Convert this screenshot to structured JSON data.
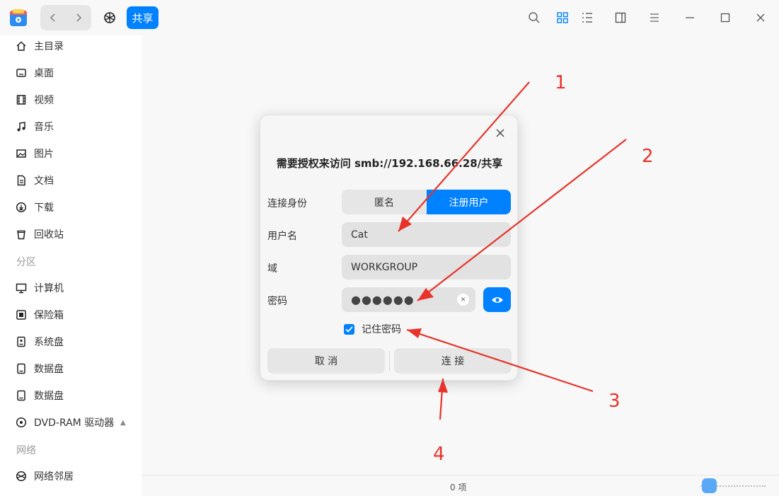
{
  "breadcrumb": {
    "current": "共享"
  },
  "sidebar": {
    "items": [
      {
        "label": "主目录",
        "icon": "home-icon"
      },
      {
        "label": "桌面",
        "icon": "desktop-icon"
      },
      {
        "label": "视频",
        "icon": "video-icon"
      },
      {
        "label": "音乐",
        "icon": "music-icon"
      },
      {
        "label": "图片",
        "icon": "image-icon"
      },
      {
        "label": "文档",
        "icon": "document-icon"
      },
      {
        "label": "下载",
        "icon": "download-icon"
      },
      {
        "label": "回收站",
        "icon": "trash-icon"
      }
    ],
    "partition_header": "分区",
    "partitions": [
      {
        "label": "计算机",
        "icon": "computer-icon"
      },
      {
        "label": "保险箱",
        "icon": "vault-icon"
      },
      {
        "label": "系统盘",
        "icon": "disk-icon"
      },
      {
        "label": "数据盘",
        "icon": "disk-icon"
      },
      {
        "label": "数据盘",
        "icon": "disk-icon"
      },
      {
        "label": "DVD-RAM 驱动器",
        "icon": "optical-drive-icon"
      }
    ],
    "network_header": "网络",
    "network": [
      {
        "label": "网络邻居",
        "icon": "network-icon"
      }
    ]
  },
  "status": {
    "count": "0 项"
  },
  "dialog": {
    "title": "需要授权来访问 smb://192.168.66.28/共享",
    "identity_label": "连接身份",
    "identity_options": [
      "匿名",
      "注册用户"
    ],
    "identity_selected": "注册用户",
    "username_label": "用户名",
    "username_value": "Cat",
    "domain_label": "域",
    "domain_value": "WORKGROUP",
    "password_label": "密码",
    "password_mask": "●●●●●●",
    "remember_label": "记住密码",
    "remember_checked": true,
    "cancel_label": "取 消",
    "connect_label": "连 接"
  },
  "annotations": {
    "n1": "1",
    "n2": "2",
    "n3": "3",
    "n4": "4"
  },
  "colors": {
    "accent": "#0081ff",
    "annotation": "#e8332b"
  }
}
